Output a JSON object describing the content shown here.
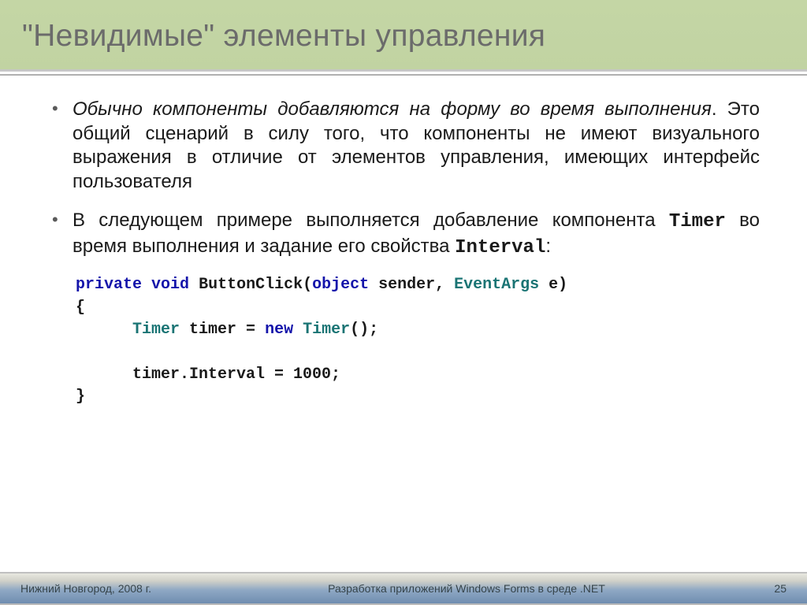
{
  "header": {
    "title": "\"Невидимые\" элементы управления"
  },
  "bullets": [
    {
      "italic_lead": "Обычно компоненты добавляются на форму во время выполнения",
      "rest": ". Это общий сценарий в силу того, что компоненты не имеют визуального выражения в отличие от элементов управления, имеющих интерфейс пользователя"
    },
    {
      "pre1": "В следующем примере выполняется добавление компонента ",
      "mono1": "Timer",
      "mid": " во время выполнения и задание его свойства ",
      "mono2": "Interval",
      "post": ":"
    }
  ],
  "code": {
    "kw_private": "private",
    "kw_void": "void",
    "fn": "ButtonClick(",
    "kw_object": "object",
    "arg1_rest": " sender, ",
    "tp_eventargs": "EventArgs",
    "arg2_rest": " e)",
    "brace_open": "{",
    "indent": "      ",
    "tp_timer1": "Timer",
    "line2_mid": " timer = ",
    "kw_new": "new",
    "space": " ",
    "tp_timer2": "Timer",
    "line2_end": "();",
    "blank": "",
    "line3": "timer.Interval = 1000;",
    "brace_close": "}"
  },
  "footer": {
    "left": "Нижний Новгород, 2008 г.",
    "center": "Разработка приложений Windows Forms в среде .NET",
    "page": "25"
  }
}
